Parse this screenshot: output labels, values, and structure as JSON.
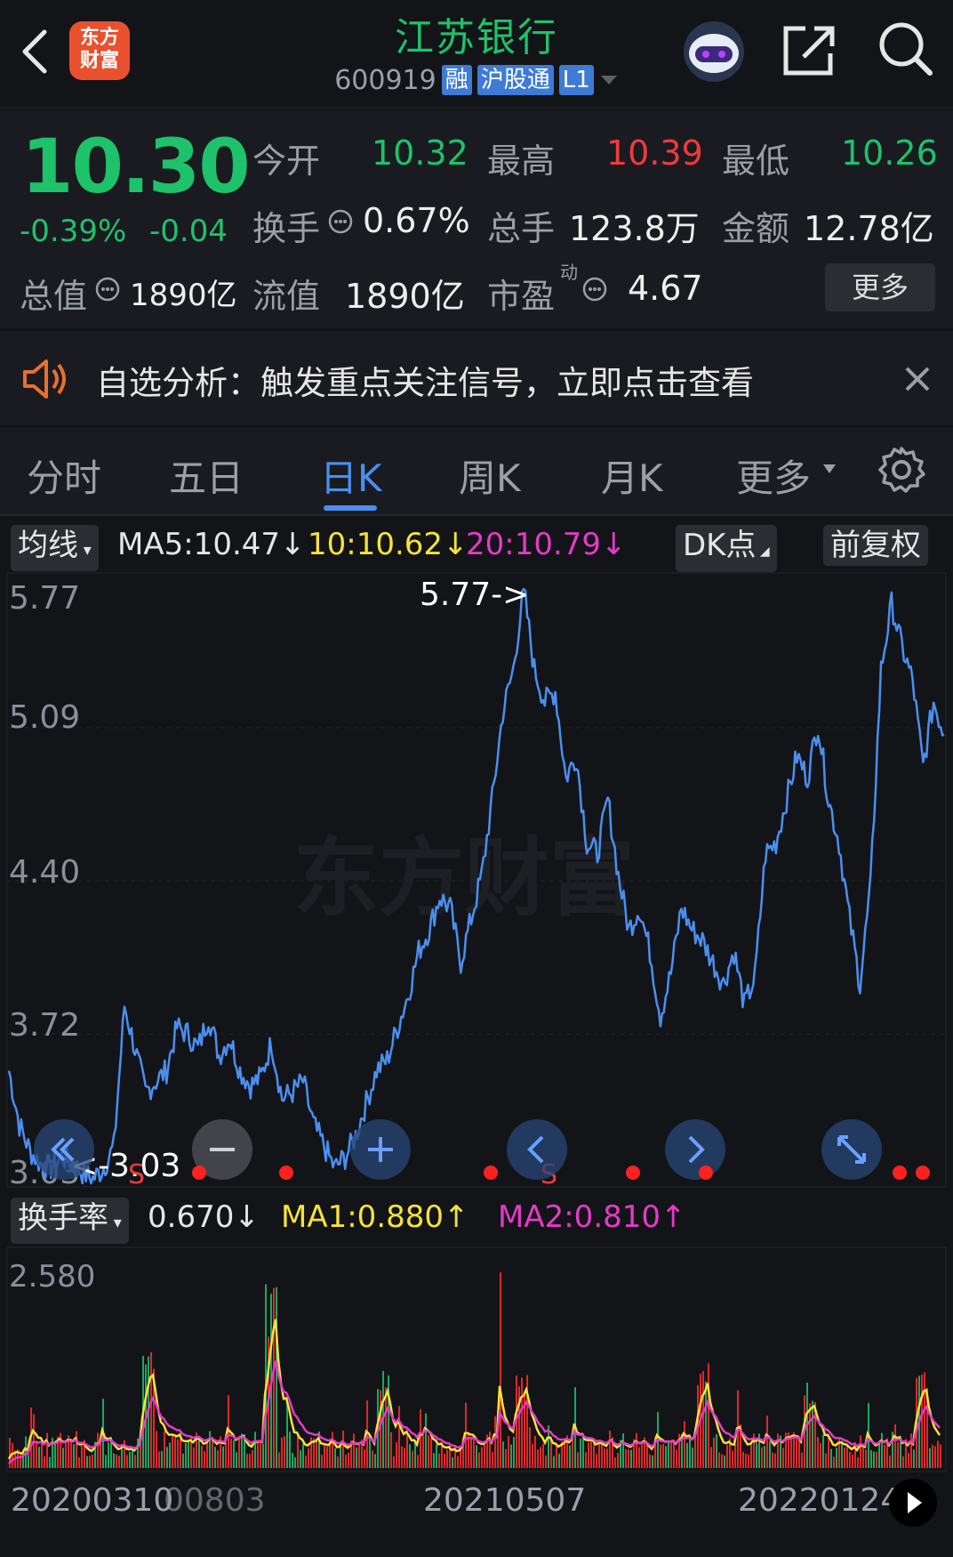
{
  "header": {
    "app_logo_text": [
      "东方",
      "财富"
    ],
    "stock_name": "江苏银行",
    "stock_code": "600919",
    "tags": [
      "融",
      "沪股通",
      "L1"
    ]
  },
  "quote": {
    "price": "10.30",
    "change_pct": "-0.39%",
    "change": "-0.04",
    "fields": {
      "open_label": "今开",
      "open": "10.32",
      "high_label": "最高",
      "high": "10.39",
      "low_label": "最低",
      "low": "10.26",
      "turnover_label": "换手",
      "turnover": "0.67%",
      "volume_label": "总手",
      "volume": "123.8万",
      "amount_label": "金额",
      "amount": "12.78亿",
      "mktcap_label": "总值",
      "mktcap": "1890亿",
      "float_label": "流值",
      "float": "1890亿",
      "pe_label": "市盈",
      "pe_sup": "动",
      "pe": "4.67"
    },
    "more_button": "更多"
  },
  "notice": {
    "text": "自选分析：触发重点关注信号，立即点击查看"
  },
  "tabs": [
    "分时",
    "五日",
    "日K",
    "周K",
    "月K",
    "更多"
  ],
  "active_tab": "日K",
  "ma_bar": {
    "selector": "均线",
    "ma5": "MA5:10.47",
    "ma10": "10:10.62",
    "ma20": "20:10.79",
    "dk_button": "DK点",
    "adjust_button": "前复权"
  },
  "price_chart": {
    "y_labels": [
      "5.77",
      "5.09",
      "4.40",
      "3.72",
      "3.03"
    ],
    "max_marker": "5.77->",
    "min_marker": "<-3.03",
    "watermark": "东方财富",
    "signal_marks": [
      "S",
      "S"
    ],
    "line_color": "#4a8ff0"
  },
  "volume_bar": {
    "selector": "换手率",
    "value": "0.670",
    "ma1": "MA1:0.880",
    "ma2": "MA2:0.810",
    "max_label": "2.580"
  },
  "x_labels": [
    "20200310",
    "00803",
    "20210507",
    "20220124"
  ],
  "colors": {
    "up": "#f03a3a",
    "down": "#1ec26a",
    "accent": "#4a8ff0",
    "ma1": "#f5e23a",
    "ma2": "#e53ac8"
  },
  "chart_data": {
    "type": "line",
    "series": [
      {
        "values": [
          3.55,
          3.3,
          3.18,
          3.12,
          3.1,
          3.15,
          3.12,
          3.08,
          3.05,
          3.1,
          3.2,
          3.85,
          3.65,
          3.45,
          3.5,
          3.55,
          3.75,
          3.72,
          3.65,
          3.8,
          3.62,
          3.7,
          3.55,
          3.48,
          3.52,
          3.68,
          3.42,
          3.45,
          3.5,
          3.3,
          3.2,
          3.1,
          3.15,
          3.25,
          3.4,
          3.55,
          3.6,
          3.75,
          3.9,
          4.1,
          4.2,
          4.35,
          4.3,
          4.05,
          4.25,
          4.45,
          4.8,
          5.2,
          5.4,
          5.77,
          5.4,
          5.25,
          5.3,
          4.9,
          5.0,
          4.6,
          4.55,
          4.8,
          4.45,
          4.2,
          4.3,
          4.1,
          3.8,
          4.0,
          4.3,
          4.2,
          4.15,
          4.05,
          3.95,
          4.1,
          3.85,
          3.98,
          4.55,
          4.6,
          4.8,
          5.0,
          4.9,
          5.15,
          4.8,
          4.6,
          4.25,
          3.95,
          4.4,
          5.4,
          5.7,
          5.5,
          5.35,
          4.95,
          5.25,
          5.1
        ]
      }
    ],
    "ylim": [
      3.03,
      5.77
    ]
  }
}
